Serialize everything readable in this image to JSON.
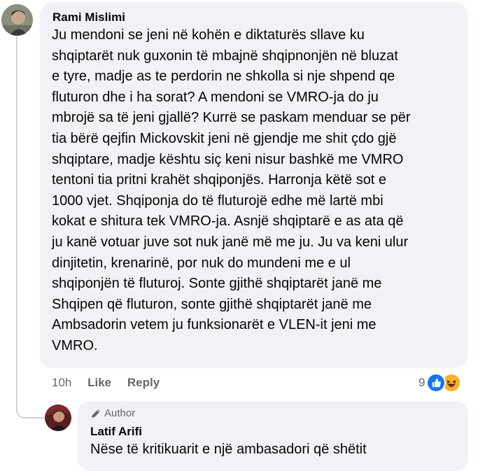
{
  "comment": {
    "author": "Rami Mislimi",
    "text_lines": [
      "Ju mendoni se jeni në kohën e diktaturës sllave ku",
      "shqiptarët nuk guxonin të mbajnë shqipnonjën në bluzat",
      "e tyre, madje as te perdorin ne shkolla si nje shpend qe",
      "fluturon dhe i ha sorat? A mendoni se VMRO-ja do ju",
      "mbrojë sa të jeni gjallë? Kurrë se paskam menduar se për",
      "tia bërë qejfin Mickovskit jeni në gjendje me shit çdo gjë",
      "shqiptare, madje kështu siç keni nisur bashkë me VMRO",
      "tentoni tia pritni krahët shqiponjës. Harronja këtë sot e",
      "1000 vjet. Shqiponja do të fluturojë edhe më lartë mbi",
      "kokat e shitura tek VMRO-ja. Asnjë shqiptarë e as ata që",
      "ju kanë votuar juve sot nuk janë më me ju. Ju va keni ulur",
      "dinjitetin, krenarinë, por nuk do mundeni me e ul",
      "shqiponjën të fluturoj. Sonte gjithë shqiptarët janë me",
      "Shqipen që fluturon, sonte gjithë shqiptarët janë me",
      "Ambsadorin vetem ju funksionarët e VLEN-it jeni me",
      "VMRO."
    ],
    "time": "10h",
    "like_label": "Like",
    "reply_label": "Reply",
    "reaction_count": "9",
    "reaction_icons": [
      "like-icon",
      "haha-icon"
    ],
    "colors": {
      "like": "#1877f2",
      "haha": "#f7b125"
    }
  },
  "reply": {
    "badge_label": "Author",
    "badge_icon": "pen-icon",
    "author": "Latif Arifi",
    "text_lines": [
      "Nëse të kritikuarit e një ambasadori që shëtit"
    ]
  }
}
